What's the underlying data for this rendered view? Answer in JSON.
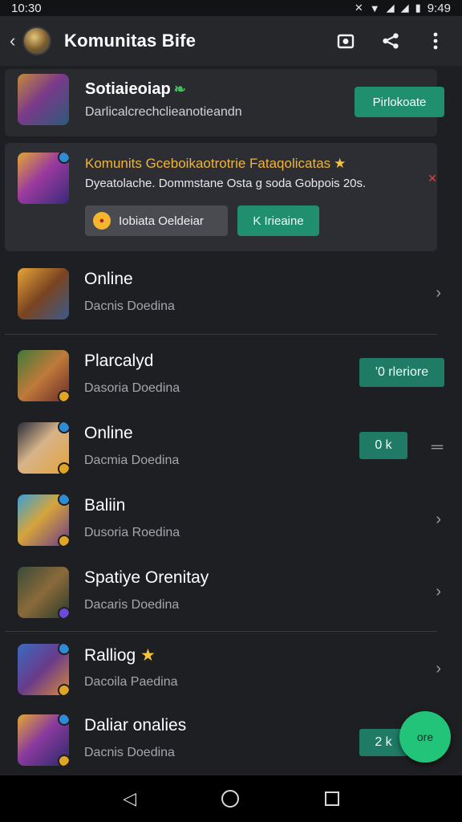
{
  "status_bar": {
    "time": "10:30",
    "clock_right": "9:49"
  },
  "app_bar": {
    "title": "Komunitas Bife"
  },
  "featured": {
    "title": "Sotiaieoiap",
    "subtitle": "Darlicalcrechclieanotieandn",
    "button": "Pirlokoate"
  },
  "promo": {
    "title": "Komunits Gceboikaotrotrie Fataqolicatas",
    "subtitle": "Dyeatolache. Dommstane Osta g soda Gobpois 20s.",
    "left_button": "Iobiata Oeldeiar",
    "right_button": "K Irieaine"
  },
  "list": [
    {
      "title": "Online",
      "subtitle": "Dacnis Doedina",
      "action": "chevron"
    },
    {
      "title": "Plarcalyd",
      "subtitle": "Dasoria Doedina",
      "action": "button",
      "button": "'0 rleriore"
    },
    {
      "title": "Online",
      "subtitle": "Dacmia Doedina",
      "action": "button",
      "button": "0 k"
    },
    {
      "title": "Baliin",
      "subtitle": "Dusoria Roedina",
      "action": "chevron"
    },
    {
      "title": "Spatiye Orenitay",
      "subtitle": "Dacaris Doedina",
      "action": "chevron"
    },
    {
      "title": "Ralliog",
      "subtitle": "Dacoila Paedina",
      "action": "chevron"
    },
    {
      "title": "Daliar onalies",
      "subtitle": "Dacnis Doedina",
      "action": "button",
      "button": "2 k"
    }
  ],
  "fab": {
    "label": "ore"
  },
  "colors": {
    "accent": "#1f8f6e",
    "fab": "#22c47a",
    "promo_title": "#f0b43a",
    "background": "#1e1f22"
  }
}
